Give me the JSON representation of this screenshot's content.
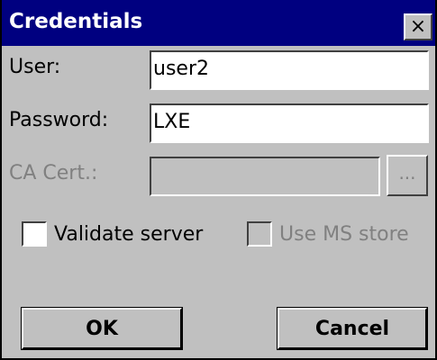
{
  "window": {
    "title": "Credentials",
    "close_label": "×"
  },
  "form": {
    "user_label": "User:",
    "user_value": "user2",
    "password_label": "Password:",
    "password_value": "LXE",
    "ca_cert_label": "CA Cert.:",
    "ca_cert_value": "",
    "browse_label": "...",
    "validate_server_label": "Validate server",
    "validate_server_checked": false,
    "use_ms_store_label": "Use MS store",
    "use_ms_store_checked": false,
    "use_ms_store_enabled": false,
    "ca_cert_enabled": false
  },
  "buttons": {
    "ok_label": "OK",
    "cancel_label": "Cancel"
  }
}
